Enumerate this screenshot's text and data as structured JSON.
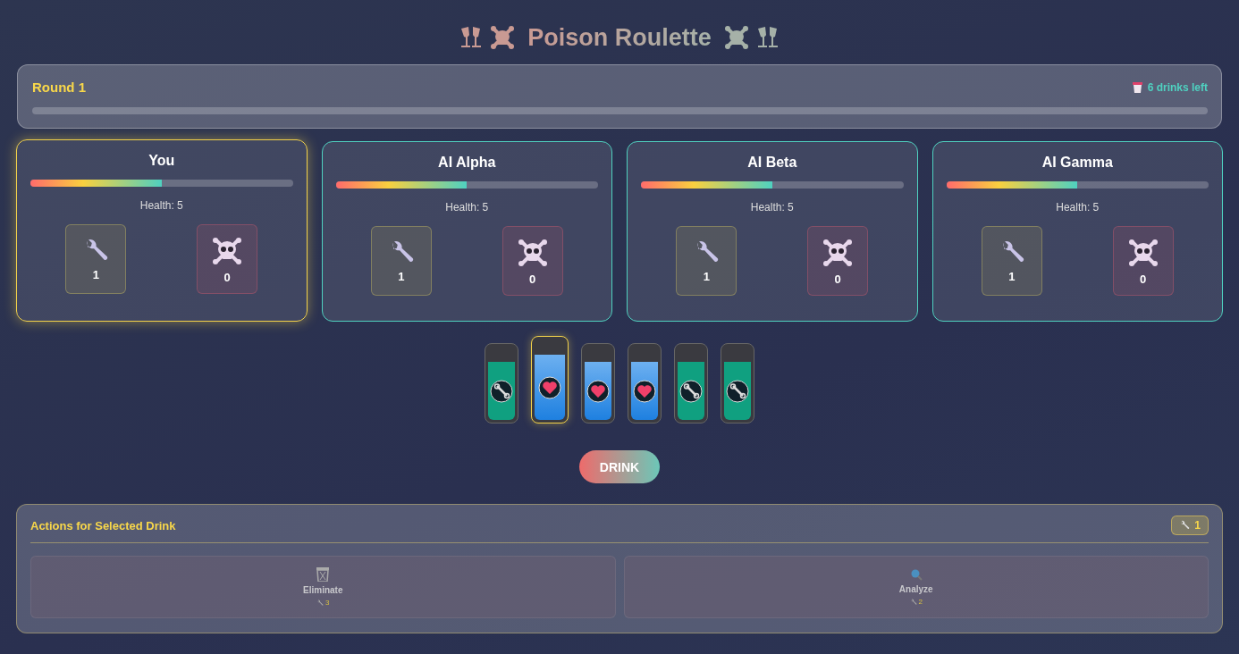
{
  "title": "Poison Roulette",
  "round": {
    "label": "Round 1",
    "drinks_left": "6 drinks left"
  },
  "players": [
    {
      "name": "You",
      "selected": true,
      "health_bar": {
        "level": 0.5
      },
      "health": "Health: 5",
      "tools": "1",
      "poisons": "0"
    },
    {
      "name": "AI Alpha",
      "selected": false,
      "health_bar": {
        "level": 0.5
      },
      "health": "Health: 5",
      "tools": "1",
      "poisons": "0"
    },
    {
      "name": "AI Beta",
      "selected": false,
      "health_bar": {
        "level": 0.5
      },
      "health": "Health: 5",
      "tools": "1",
      "poisons": "0"
    },
    {
      "name": "AI Gamma",
      "selected": false,
      "health_bar": {
        "level": 0.5
      },
      "health": "Health: 5",
      "tools": "1",
      "poisons": "0"
    }
  ],
  "drinks": [
    {
      "kind": "tool",
      "selected": false
    },
    {
      "kind": "heart",
      "selected": true
    },
    {
      "kind": "heart",
      "selected": false
    },
    {
      "kind": "heart",
      "selected": false
    },
    {
      "kind": "tool",
      "selected": false
    },
    {
      "kind": "tool",
      "selected": false
    }
  ],
  "drink_button": "DRINK",
  "actions": {
    "title": "Actions for Selected Drink",
    "tools": "1",
    "items": [
      {
        "kind": "eliminate",
        "label": "Eliminate",
        "cost": "3",
        "disabled": true
      },
      {
        "kind": "analyze",
        "label": "Analyze",
        "cost": "2",
        "disabled": true
      }
    ]
  }
}
